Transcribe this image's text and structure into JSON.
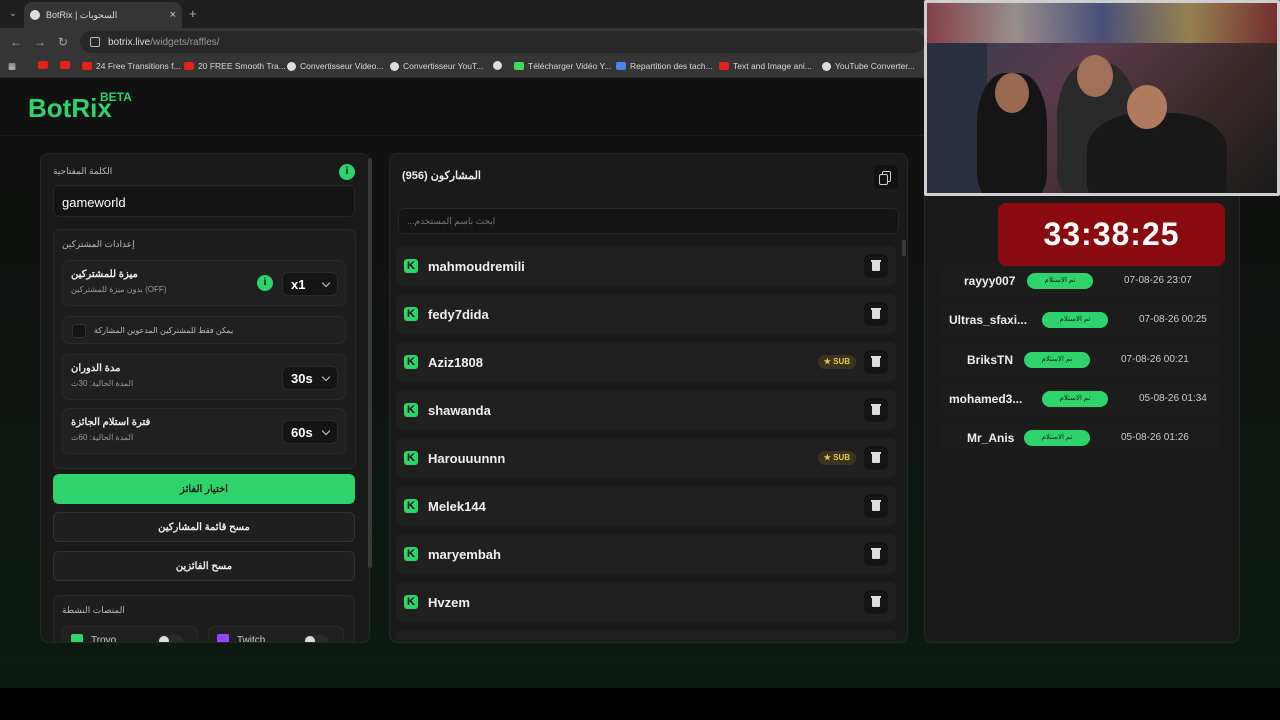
{
  "browser": {
    "tab_title": "BotRix | السحوبات",
    "url_host": "botrix.live",
    "url_path": "/widgets/raffles/",
    "bookmarks": [
      "24 Free Transitions f...",
      "20 FREE Smooth Tra...",
      "Convertisseur Video...",
      "Convertisseur YouT...",
      "Télécharger Vidéo Y...",
      "Repartition des tach...",
      "Text and Image ani...",
      "YouTube Converter..."
    ]
  },
  "app": {
    "logo": "BotRix",
    "beta": "BETA"
  },
  "settings": {
    "keyword_label": "الكلمة المفتاحية",
    "keyword_value": "gameworld",
    "participants_settings_label": "إعدادات المشتركين",
    "subscriber_luck_label": "ميزة للمشتركين",
    "subscriber_luck_sub": "بدون ميزة للمشتركين (OFF)",
    "subscriber_luck_value": "x1",
    "subs_only_label": "يمكن فقط للمشتركين المدعوين المشاركة",
    "spin_duration_label": "مدة الدوران",
    "spin_duration_sub": "المدة الحالية: 30ث",
    "spin_duration_value": "30s",
    "claim_time_label": "فترة استلام الجائزة",
    "claim_time_sub": "المدة الحالية: 60ث",
    "claim_time_value": "60s",
    "pick_winner": "اختيار الفائز",
    "clear_participants": "مسح قائمة المشاركين",
    "clear_winners": "مسح الفائزين",
    "active_platforms": "المنصات النشطة",
    "platform_1": "Trovo",
    "platform_2": "Twitch"
  },
  "participants": {
    "title": "المشاركون (956)",
    "search_placeholder": "ابحث باسم المستخدم...",
    "sub_label": "SUB",
    "items": [
      {
        "name": "mahmoudremili"
      },
      {
        "name": "fedy7dida"
      },
      {
        "name": "Aziz1808"
      },
      {
        "name": "shawanda"
      },
      {
        "name": "Harouuunnn"
      },
      {
        "name": "Melek144"
      },
      {
        "name": "maryembah"
      },
      {
        "name": "Hvzem"
      }
    ]
  },
  "timer": {
    "value": "33:38:25"
  },
  "winners": {
    "claimed_label": "تم الاستلام",
    "items": [
      {
        "name": "rayyy007",
        "date": "07-08-26 23:07"
      },
      {
        "name": "Ultras_sfaxi...",
        "date": "07-08-26 00:25"
      },
      {
        "name": "BriksTN",
        "date": "07-08-26 00:21"
      },
      {
        "name": "mohamed3...",
        "date": "05-08-26 01:34"
      },
      {
        "name": "Mr_Anis",
        "date": "05-08-26 01:26"
      }
    ]
  }
}
